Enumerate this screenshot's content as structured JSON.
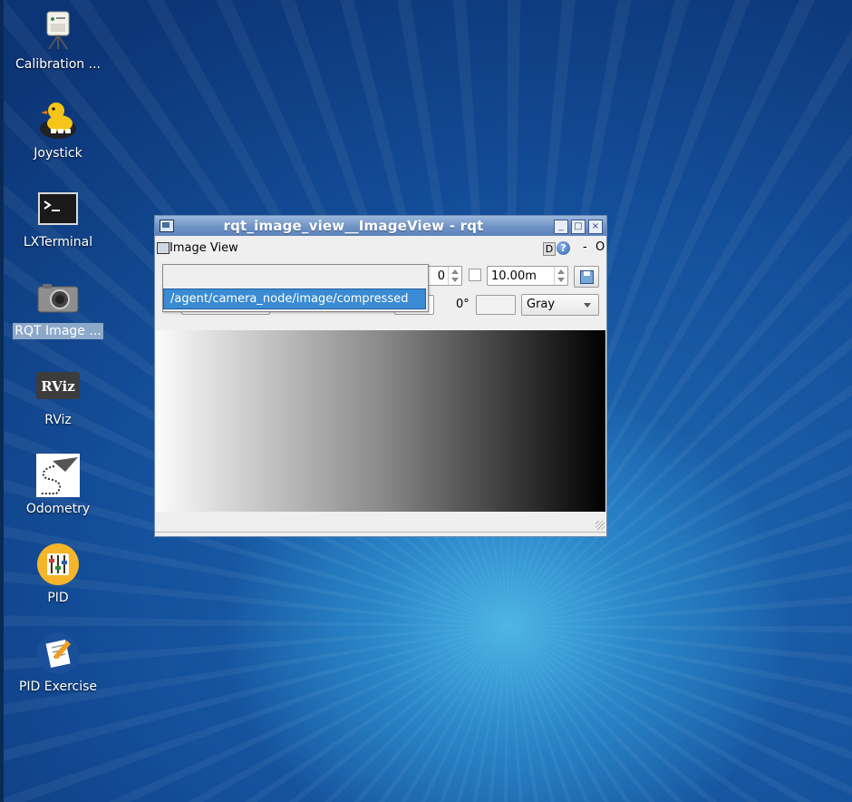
{
  "desktop": {
    "icons": [
      {
        "label": "Calibration ...",
        "icon": "calibration-icon",
        "selected": false
      },
      {
        "label": "Joystick",
        "icon": "joystick-duck-icon",
        "selected": false
      },
      {
        "label": "LXTerminal",
        "icon": "terminal-icon",
        "selected": false
      },
      {
        "label": "RQT Image ...",
        "icon": "camera-icon",
        "selected": true
      },
      {
        "label": "RViz",
        "icon": "rviz-icon",
        "selected": false
      },
      {
        "label": "Odometry",
        "icon": "odometry-path-icon",
        "selected": false
      },
      {
        "label": "PID",
        "icon": "pid-sliders-icon",
        "selected": false
      },
      {
        "label": "PID Exercise",
        "icon": "pid-exercise-icon",
        "selected": false
      }
    ]
  },
  "window": {
    "title": "rqt_image_view__ImageView - rqt",
    "dock_title": "Image View",
    "dock_d": "D",
    "dock_help": "?",
    "dock_minimize": "-",
    "dock_close": "O",
    "toolbar": {
      "spin_partial_value": "0",
      "smooth_checked": false,
      "max_range_value": "10.00m",
      "rotation_label": "0°",
      "colormap_value": "Gray"
    },
    "topic_popup": {
      "blank_option": "",
      "selected_option": "/agent/camera_node/image/compressed"
    }
  },
  "colors": {
    "title_gradient_top": "#9bb7dc",
    "selection_blue": "#3b8bd2",
    "desktop_blue": "#144f9a"
  }
}
